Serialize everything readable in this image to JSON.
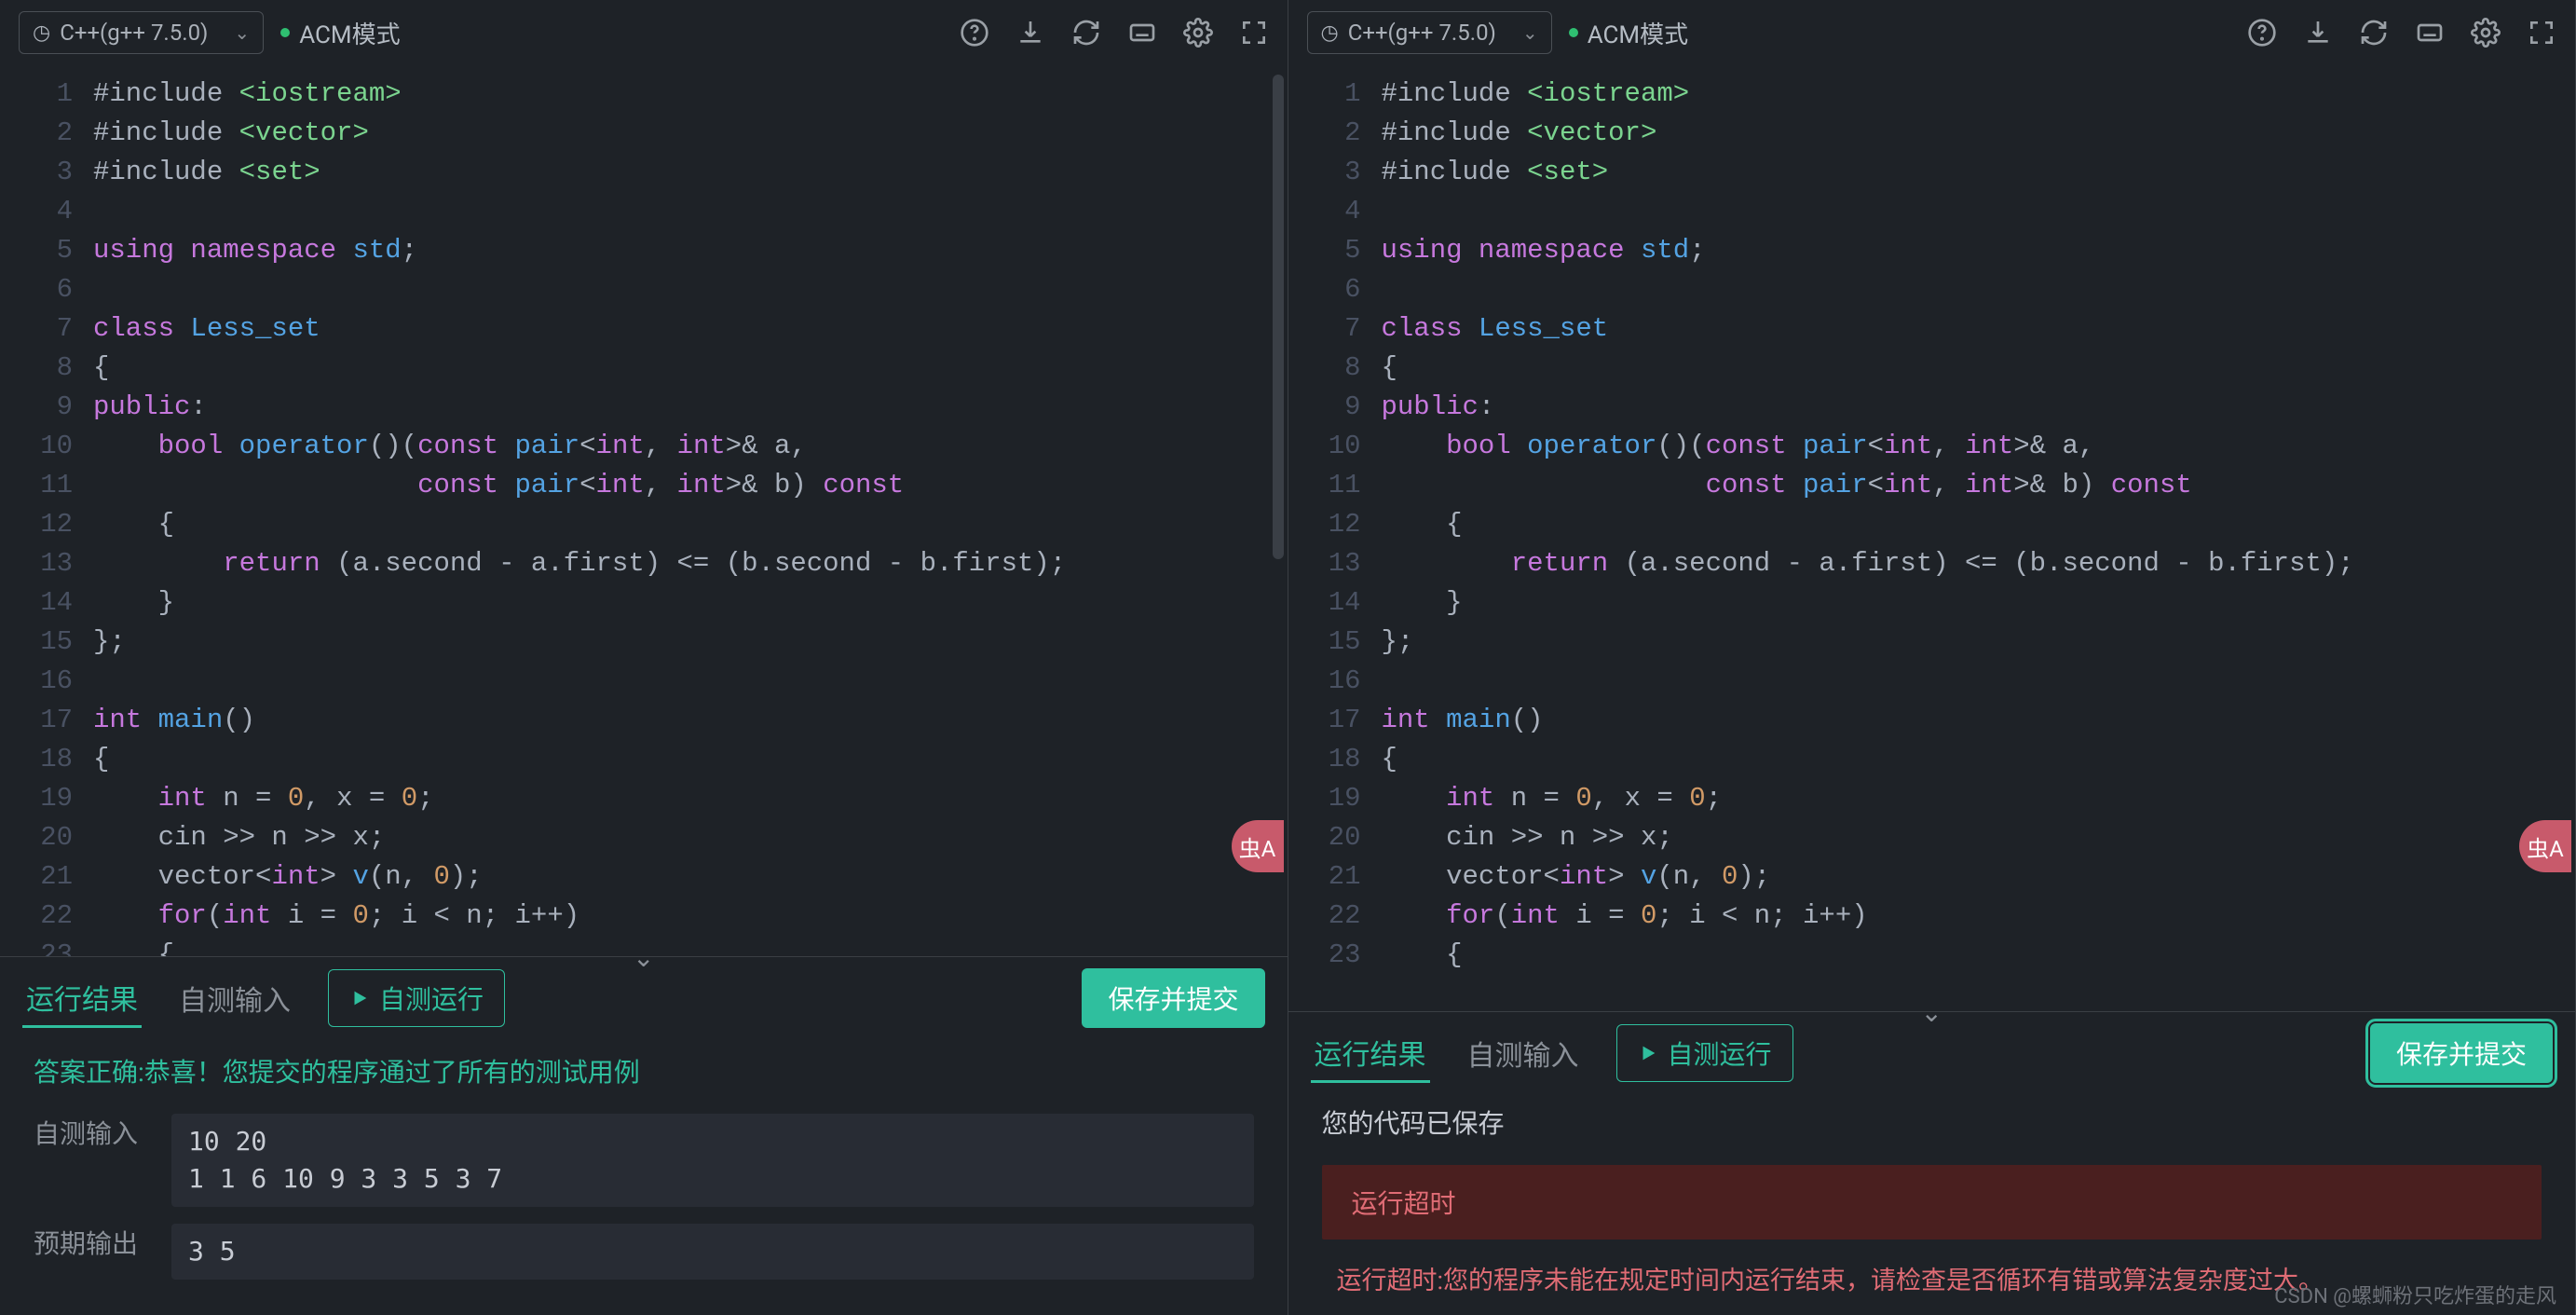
{
  "toolbar": {
    "language": "C++(g++ 7.5.0)",
    "mode": "ACM模式",
    "icons": [
      "help",
      "download",
      "refresh",
      "keyboard",
      "settings",
      "fullscreen"
    ]
  },
  "code": [
    {
      "n": 1,
      "seg": [
        [
          "",
          "#include "
        ],
        [
          "g",
          "<iostream>"
        ]
      ]
    },
    {
      "n": 2,
      "seg": [
        [
          "",
          "#include "
        ],
        [
          "g",
          "<vector>"
        ]
      ]
    },
    {
      "n": 3,
      "seg": [
        [
          "",
          "#include "
        ],
        [
          "g",
          "<set>"
        ]
      ]
    },
    {
      "n": 4,
      "seg": [
        [
          "",
          ""
        ]
      ]
    },
    {
      "n": 5,
      "seg": [
        [
          "u",
          "using "
        ],
        [
          "u",
          "namespace "
        ],
        [
          "b",
          "std"
        ],
        [
          "",
          ";"
        ]
      ]
    },
    {
      "n": 6,
      "seg": [
        [
          "",
          ""
        ]
      ]
    },
    {
      "n": 7,
      "seg": [
        [
          "u",
          "class "
        ],
        [
          "b",
          "Less_set"
        ]
      ]
    },
    {
      "n": 8,
      "seg": [
        [
          "",
          "{"
        ]
      ]
    },
    {
      "n": 9,
      "seg": [
        [
          "u",
          "public"
        ],
        [
          "",
          ":"
        ]
      ]
    },
    {
      "n": 10,
      "seg": [
        [
          "",
          "    "
        ],
        [
          "u",
          "bool "
        ],
        [
          "b",
          "operator"
        ],
        [
          "",
          "()("
        ],
        [
          "u",
          "const "
        ],
        [
          "b",
          "pair"
        ],
        [
          "",
          "<"
        ],
        [
          "u",
          "int"
        ],
        [
          "",
          ", "
        ],
        [
          "u",
          "int"
        ],
        [
          "",
          ">& a,"
        ]
      ]
    },
    {
      "n": 11,
      "seg": [
        [
          "",
          "                    "
        ],
        [
          "u",
          "const "
        ],
        [
          "b",
          "pair"
        ],
        [
          "",
          "<"
        ],
        [
          "u",
          "int"
        ],
        [
          "",
          ", "
        ],
        [
          "u",
          "int"
        ],
        [
          "",
          ">& b) "
        ],
        [
          "u",
          "const"
        ]
      ]
    },
    {
      "n": 12,
      "seg": [
        [
          "",
          "    {"
        ]
      ]
    },
    {
      "n": 13,
      "seg": [
        [
          "",
          "        "
        ],
        [
          "u",
          "return "
        ],
        [
          "",
          "(a.second - a.first) <= (b.second - b.first);"
        ]
      ]
    },
    {
      "n": 14,
      "seg": [
        [
          "",
          "    }"
        ]
      ]
    },
    {
      "n": 15,
      "seg": [
        [
          "",
          "};"
        ]
      ]
    },
    {
      "n": 16,
      "seg": [
        [
          "",
          ""
        ]
      ]
    },
    {
      "n": 17,
      "seg": [
        [
          "u",
          "int "
        ],
        [
          "b",
          "main"
        ],
        [
          "",
          "()"
        ]
      ]
    },
    {
      "n": 18,
      "seg": [
        [
          "",
          "{"
        ]
      ]
    },
    {
      "n": 19,
      "seg": [
        [
          "",
          "    "
        ],
        [
          "u",
          "int "
        ],
        [
          "",
          "n = "
        ],
        [
          "o",
          "0"
        ],
        [
          "",
          ", x = "
        ],
        [
          "o",
          "0"
        ],
        [
          "",
          ";"
        ]
      ]
    },
    {
      "n": 20,
      "seg": [
        [
          "",
          "    cin >> n >> x;"
        ]
      ]
    },
    {
      "n": 21,
      "seg": [
        [
          "",
          "    vector<"
        ],
        [
          "u",
          "int"
        ],
        [
          "",
          "> "
        ],
        [
          "b",
          "v"
        ],
        [
          "",
          "(n, "
        ],
        [
          "o",
          "0"
        ],
        [
          "",
          ");"
        ]
      ]
    },
    {
      "n": 22,
      "seg": [
        [
          "",
          "    "
        ],
        [
          "u",
          "for"
        ],
        [
          "",
          "("
        ],
        [
          "u",
          "int"
        ],
        [
          "",
          " i = "
        ],
        [
          "o",
          "0"
        ],
        [
          "",
          "; i < n; i++)"
        ]
      ]
    },
    {
      "n": 23,
      "seg": [
        [
          "",
          "    {"
        ]
      ]
    }
  ],
  "bottom": {
    "tab_result": "运行结果",
    "tab_input": "自测输入",
    "btn_run": "自测运行",
    "btn_submit": "保存并提交"
  },
  "left_result": {
    "success_msg": "答案正确:恭喜！您提交的程序通过了所有的测试用例",
    "input_label": "自测输入",
    "input_val": "10 20\n1 1 6 10 9 3 3 5 3 7",
    "expect_label": "预期输出",
    "expect_val": "3 5"
  },
  "right_result": {
    "saved": "您的代码已保存",
    "err_title": "运行超时",
    "err_detail": "运行超时:您的程序未能在规定时间内运行结束，请检查是否循环有错或算法复杂度过大。"
  },
  "float_badge": "虫A",
  "watermark": "CSDN @螺蛳粉只吃炸蛋的走风"
}
